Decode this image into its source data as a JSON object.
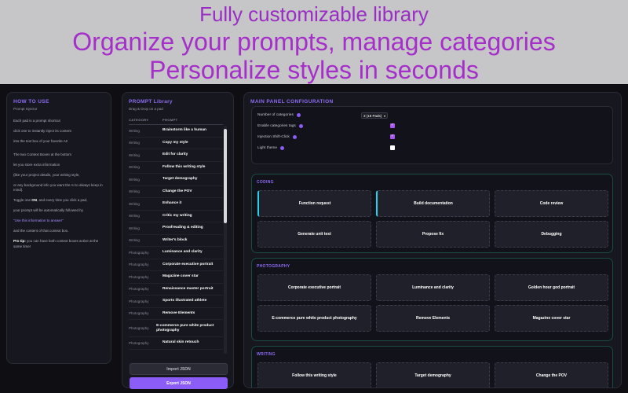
{
  "banner": {
    "line1": "Fully customizable library",
    "line2": "Organize your prompts, manage categories",
    "line3": "Personalize styles in seconds"
  },
  "howto": {
    "title": "HOW TO USE",
    "subtitle": "Prompt Injector",
    "p1": "Each pad is a prompt shortcut",
    "p2": "click one to instantly inject its content",
    "p3": "into the text box of your favorite AI!",
    "p4": "The two Context Boxes at the bottom",
    "p5": "let you store extra information",
    "p6": "(like your project details, your writing style,",
    "p7": "or any background info you want the AI to always keep in mind).",
    "p8a": "Toggle one ",
    "p8b": "ON",
    "p8c": ", and every time you click a pad,",
    "p9": "your prompt will be automatically followed by",
    "p10": "\"Use this information to answer\"",
    "p11": "and the content of that context box.",
    "p12a": "Pro tip:",
    "p12b": " you can have both context boxes active at the same time!"
  },
  "library": {
    "title": "PROMPT Library",
    "subtitle": "Drag & Drop on a pad",
    "col_category": "CATEGORY",
    "col_prompt": "PROMPT",
    "rows": [
      {
        "cat": "Writing",
        "prompt": "Brainstorm like a human"
      },
      {
        "cat": "Writing",
        "prompt": "Copy my style"
      },
      {
        "cat": "Writing",
        "prompt": "Edit for clarity"
      },
      {
        "cat": "Writing",
        "prompt": "Follow this writing style"
      },
      {
        "cat": "Writing",
        "prompt": "Target demography"
      },
      {
        "cat": "Writing",
        "prompt": "Change the POV"
      },
      {
        "cat": "Writing",
        "prompt": "Enhance it"
      },
      {
        "cat": "Writing",
        "prompt": "Critic my writing"
      },
      {
        "cat": "Writing",
        "prompt": "Proofreading & editing"
      },
      {
        "cat": "Writing",
        "prompt": "Writer's block"
      },
      {
        "cat": "Photography",
        "prompt": "Luminance and clarity"
      },
      {
        "cat": "Photography",
        "prompt": "Corporate executive portrait"
      },
      {
        "cat": "Photography",
        "prompt": "Magazine cover star"
      },
      {
        "cat": "Photography",
        "prompt": "Renaissance master portrait"
      },
      {
        "cat": "Photography",
        "prompt": "Sports illustrated athlete"
      },
      {
        "cat": "Photography",
        "prompt": "Remove Elements"
      },
      {
        "cat": "Photography",
        "prompt": "E-commerce pure white product photography"
      },
      {
        "cat": "Photography",
        "prompt": "Natural skin retouch"
      }
    ],
    "import_label": "Import JSON",
    "export_label": "Export JSON"
  },
  "main": {
    "title": "MAIN PANEL CONFIGURATION",
    "config": {
      "num_categories_label": "Number of categories",
      "num_categories_value": "3 (18 Pads)",
      "enable_tags_label": "Enable categories tags",
      "enable_tags_checked": true,
      "injection_label": "Injection Shift-Click",
      "injection_checked": true,
      "light_theme_label": "Light theme",
      "light_theme_checked": false
    },
    "sections": [
      {
        "title": "CODING",
        "pads": [
          "Function request",
          "Build documentation",
          "Code review",
          "Generate unit test",
          "Propose fix",
          "Debugging"
        ]
      },
      {
        "title": "PHOTOGRAPHY",
        "pads": [
          "Corporate executive portrait",
          "Luminance and clarity",
          "Golden hour god portrait",
          "E-commerce pure white product photography",
          "Remove Elements",
          "Magazine cover star"
        ]
      },
      {
        "title": "WRITING",
        "pads": [
          "Follow this writing style",
          "Target demography",
          "Change the POV"
        ]
      }
    ]
  },
  "colors": {
    "accent": "#8b5cf6",
    "banner_text": "#a52fc9",
    "section_border": "#1a4a44",
    "active_pad_edge": "#22d3ee"
  }
}
